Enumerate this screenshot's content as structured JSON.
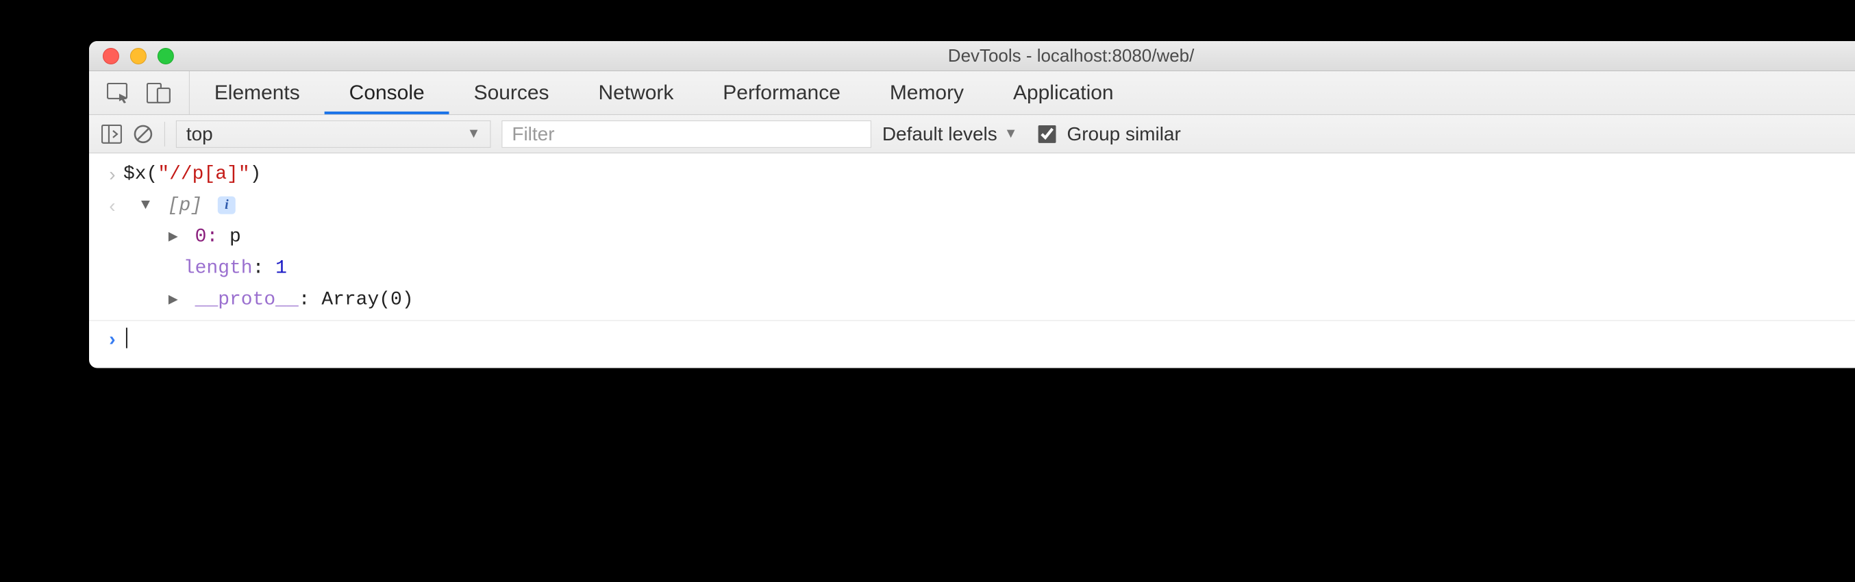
{
  "titlebar": {
    "title": "DevTools - localhost:8080/web/"
  },
  "tabs": {
    "items": [
      "Elements",
      "Console",
      "Sources",
      "Network",
      "Performance",
      "Memory",
      "Application"
    ],
    "active_index": 1,
    "overflow_glyph": "»"
  },
  "toolbar": {
    "context": "top",
    "filter_placeholder": "Filter",
    "levels_label": "Default levels",
    "group_checked": true,
    "group_label": "Group similar"
  },
  "console": {
    "input_fn": "$x",
    "input_arg": "\"//p[a]\"",
    "result_summary": "[p]",
    "prop0_key": "0",
    "prop0_val": "p",
    "length_key": "length",
    "length_val": "1",
    "proto_key": "__proto__",
    "proto_val": "Array(0)",
    "info_glyph": "i"
  }
}
